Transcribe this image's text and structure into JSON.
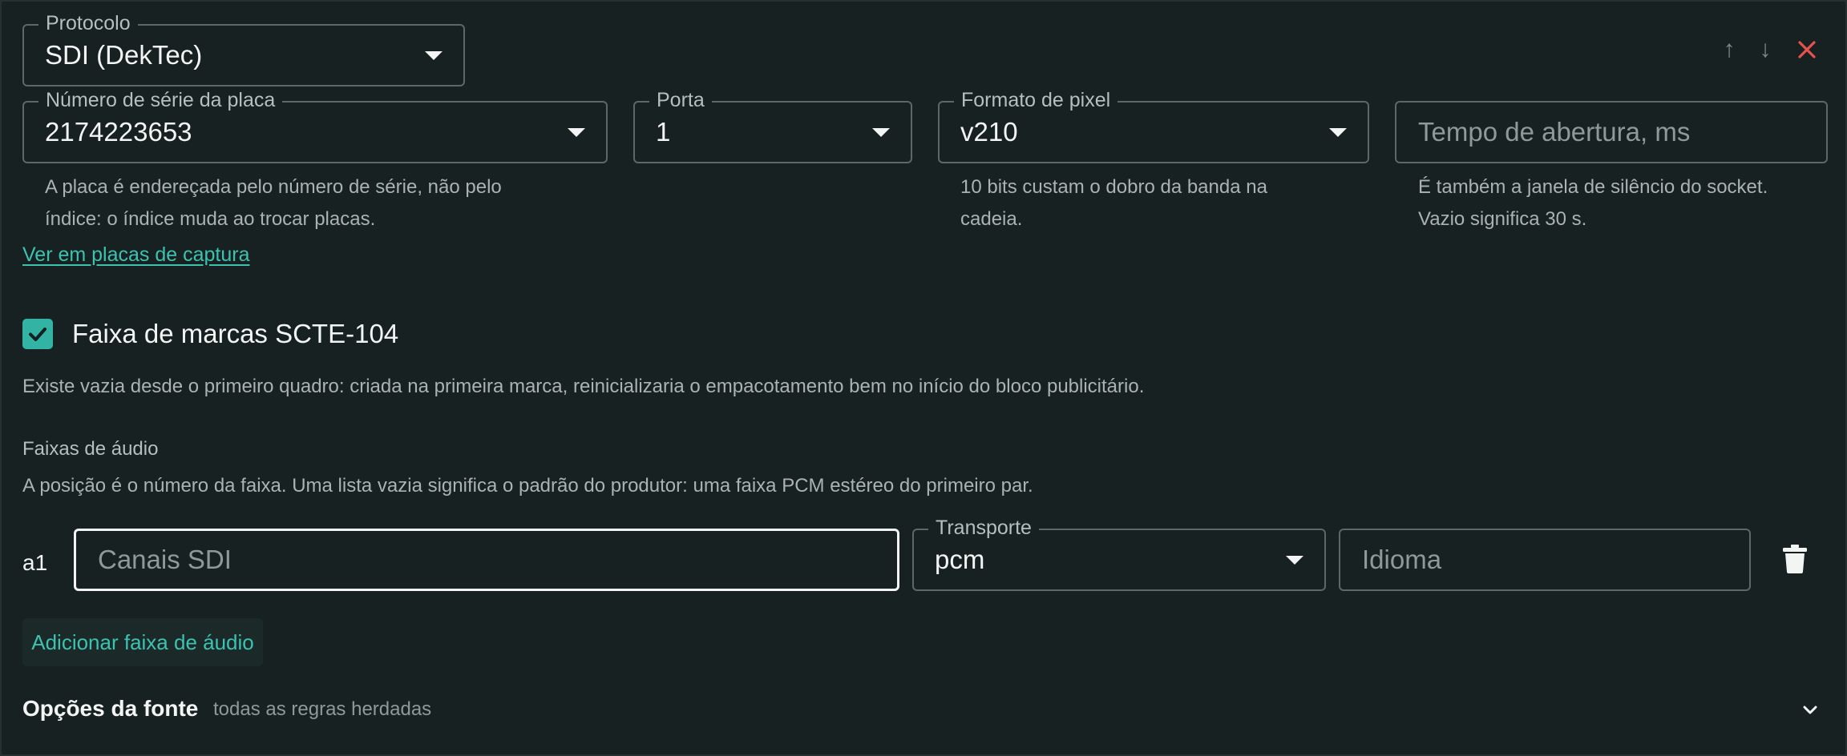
{
  "protocol": {
    "label": "Protocolo",
    "value": "SDI (DekTec)"
  },
  "header_actions": {
    "move_up_symbol": "↑",
    "move_down_symbol": "↓",
    "remove_color": "#e5534b"
  },
  "serial": {
    "label": "Número de série da placa",
    "value": "2174223653",
    "helper_line1": "A placa é endereçada pelo número de série, não pelo",
    "helper_line2": "índice: o índice muda ao trocar placas."
  },
  "port": {
    "label": "Porta",
    "value": "1"
  },
  "pixel_format": {
    "label": "Formato de pixel",
    "value": "v210",
    "helper_line1": "10 bits custam o dobro da banda na",
    "helper_line2": "cadeia."
  },
  "open_time": {
    "placeholder": "Tempo de abertura, ms",
    "helper_line1": "É também a janela de silêncio do socket.",
    "helper_line2": "Vazio significa 30 s."
  },
  "capture_link": "Ver em placas de captura",
  "scte": {
    "checked": true,
    "label": "Faixa de marcas SCTE-104",
    "description": "Existe vazia desde o primeiro quadro: criada na primeira marca, reinicializaria o empacotamento bem no início do bloco publicitário."
  },
  "audio": {
    "title": "Faixas de áudio",
    "description": "A posição é o número da faixa. Uma lista vazia significa o padrão do produtor: uma faixa PCM estéreo do primeiro par.",
    "tracks": [
      {
        "index_label": "a1",
        "channels_placeholder": "Canais SDI",
        "transport_label": "Transporte",
        "transport_value": "pcm",
        "language_placeholder": "Idioma"
      }
    ],
    "add_label": "Adicionar faixa de áudio"
  },
  "source_options": {
    "title": "Opções da fonte",
    "subtitle": "todas as regras herdadas"
  },
  "colors": {
    "accent": "#3cc2b0",
    "background": "#172121",
    "danger": "#e5534b"
  }
}
